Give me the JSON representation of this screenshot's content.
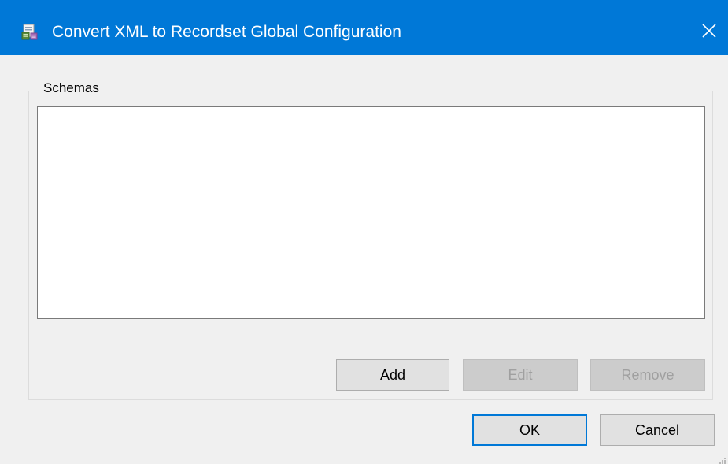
{
  "window": {
    "title": "Convert XML to Recordset Global Configuration",
    "icon": "xml-recordset-app-icon",
    "close_icon": "close-icon",
    "titlebar_color": "#0078d7"
  },
  "schemas": {
    "group_label": "Schemas",
    "items": [],
    "buttons": {
      "add_label": "Add",
      "edit_label": "Edit",
      "remove_label": "Remove"
    }
  },
  "dialog_buttons": {
    "ok_label": "OK",
    "cancel_label": "Cancel"
  }
}
